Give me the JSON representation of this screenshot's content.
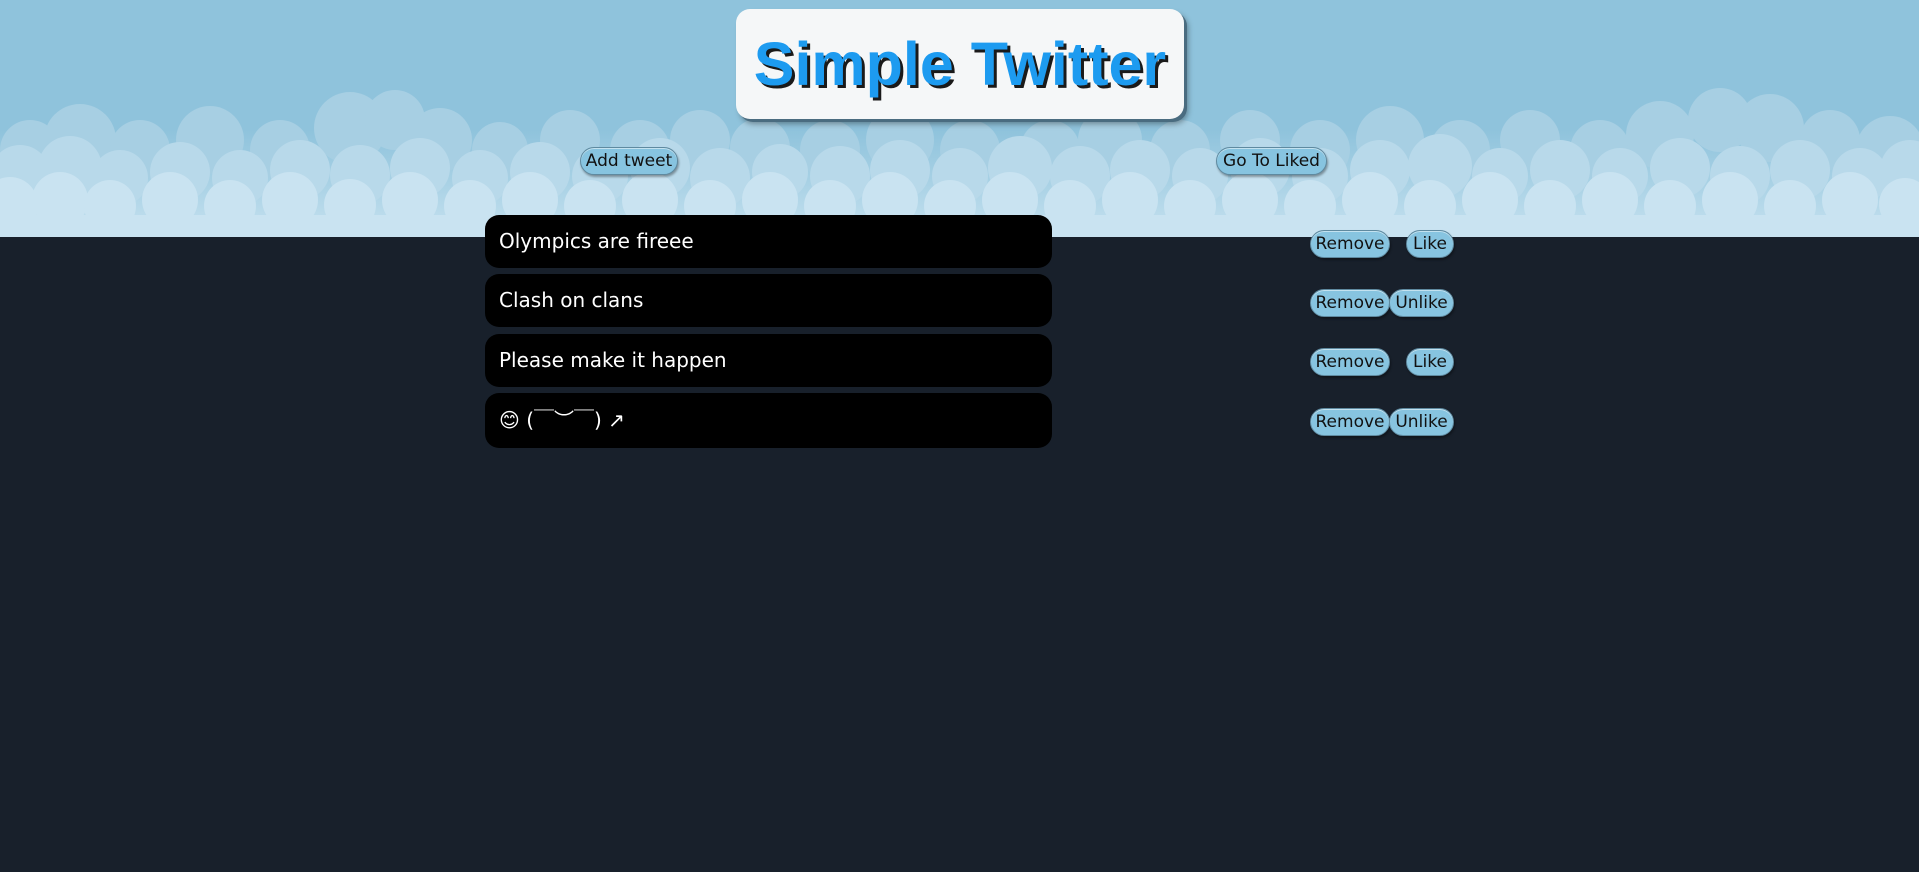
{
  "app": {
    "title": "Simple Twitter"
  },
  "toolbar": {
    "add_tweet_label": "Add tweet",
    "go_to_liked_label": "Go To Liked"
  },
  "tweets": [
    {
      "text": "Olympics are fireee",
      "remove_label": "Remove",
      "like_label": "Like",
      "liked": false
    },
    {
      "text": "Clash on clans",
      "remove_label": "Remove",
      "like_label": "Unlike",
      "liked": true
    },
    {
      "text": "Please make it happen",
      "remove_label": "Remove",
      "like_label": "Like",
      "liked": false
    },
    {
      "text": "😊 (￣︶￣) ↗",
      "remove_label": "Remove",
      "like_label": "Unlike",
      "liked": true
    }
  ],
  "colors": {
    "background": "#18202b",
    "sky": "#8fc3dc",
    "cloud": "#c7e2f0",
    "title_text": "#1d9bf0",
    "button": "#87c4e0",
    "tweet_bg": "#000000"
  }
}
